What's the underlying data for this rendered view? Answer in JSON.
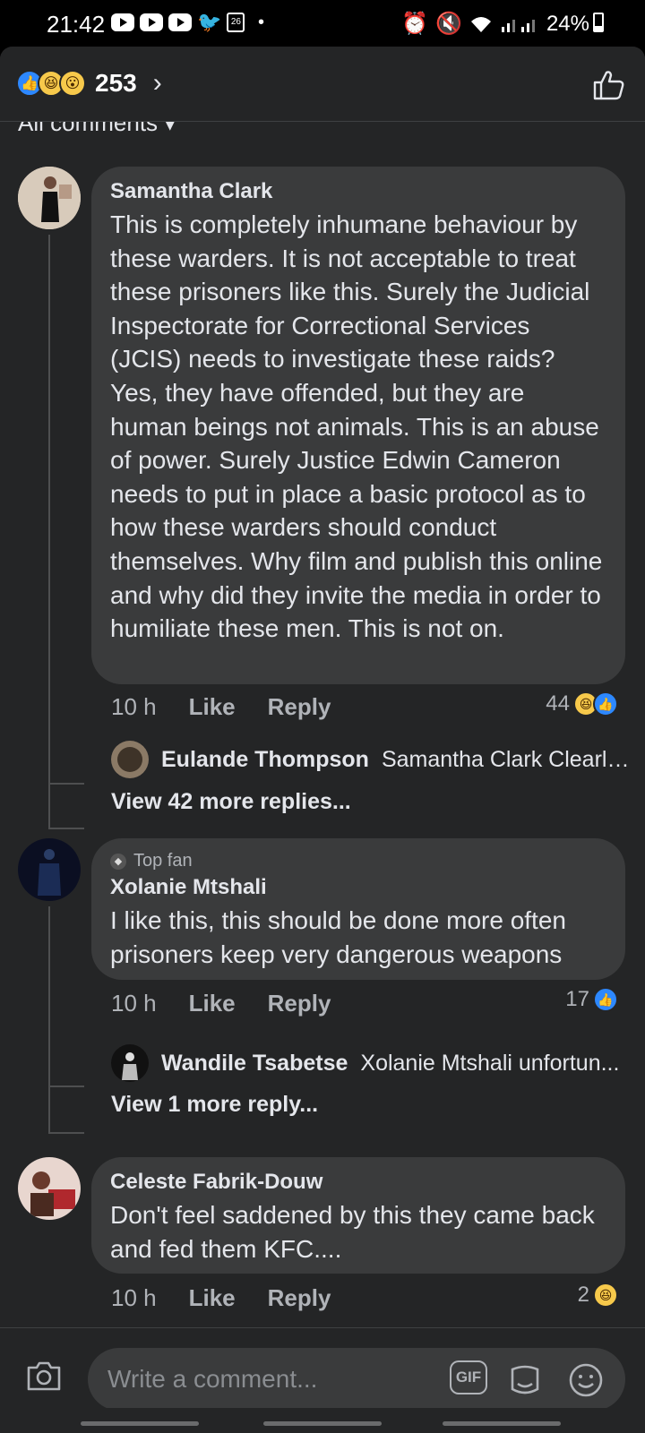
{
  "status": {
    "time": "21:42",
    "calendar_day": "26",
    "battery": "24%"
  },
  "header": {
    "reaction_icons": [
      "like-icon",
      "haha-icon",
      "wow-icon"
    ],
    "reaction_count": "253",
    "chevron": "›"
  },
  "filter": {
    "label": "All comments ▾"
  },
  "comments": [
    {
      "author": "Samantha Clark",
      "text": "This is completely inhumane behaviour by these warders. It is not acceptable to treat these prisoners like this. Surely the Judicial Inspectorate for Correctional Services (JCIS) needs to investigate these raids? Yes, they have offended, but they are human beings not animals. This is an abuse of power. Surely Justice Edwin Cameron needs to put in place a basic protocol as to how these warders should conduct themselves. Why film and publish this online and why did they invite the media in order to humiliate these men. This is not on.",
      "time": "10 h",
      "like_label": "Like",
      "reply_label": "Reply",
      "reaction_count": "44",
      "reply_preview": {
        "name": "Eulande Thompson",
        "snippet": "Samantha Clark Clearly..."
      },
      "view_more": "View 42 more replies..."
    },
    {
      "badge": "Top fan",
      "author": "Xolanie Mtshali",
      "text": "I like this, this should be done more often prisoners keep very dangerous weapons",
      "time": "10 h",
      "like_label": "Like",
      "reply_label": "Reply",
      "reaction_count": "17",
      "reply_preview": {
        "name": "Wandile Tsabetse",
        "snippet": "Xolanie Mtshali unfortun..."
      },
      "view_more": "View 1 more reply..."
    },
    {
      "author": "Celeste Fabrik-Douw",
      "text": "Don't feel saddened by this they came back and fed them KFC....",
      "time": "10 h",
      "like_label": "Like",
      "reply_label": "Reply",
      "reaction_count": "2"
    }
  ],
  "composer": {
    "placeholder": "Write a comment...",
    "gif_label": "GIF"
  },
  "colors": {
    "surface": "#242526",
    "bubble": "#3a3b3c",
    "like_blue": "#2d88ff",
    "haha_yellow": "#f7c94b"
  }
}
